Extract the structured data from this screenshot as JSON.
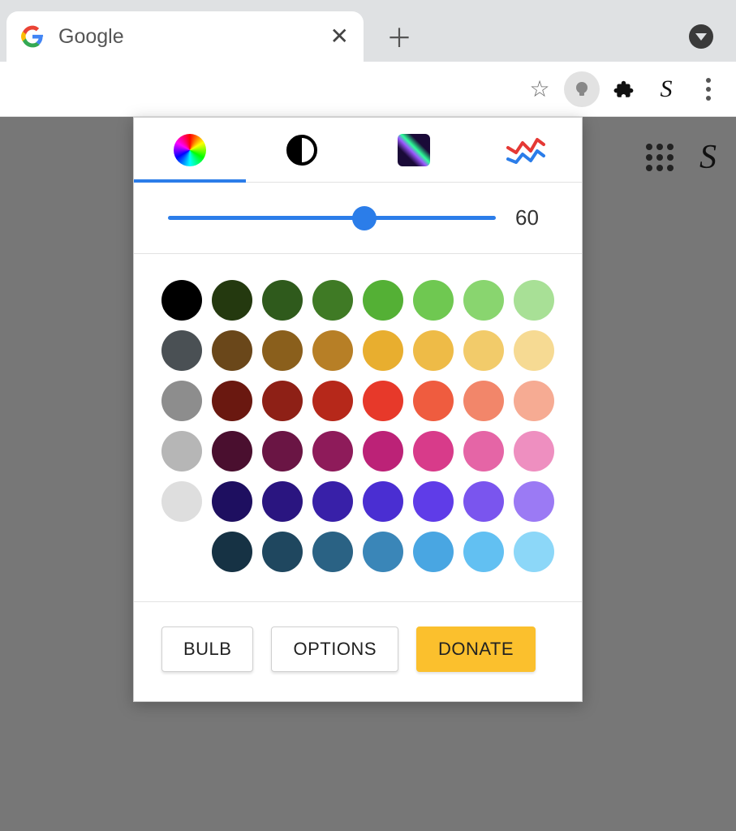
{
  "tab": {
    "title": "Google"
  },
  "popup": {
    "slider_value": "60",
    "slider_percent": 60,
    "buttons": {
      "bulb": "BULB",
      "options": "OPTIONS",
      "donate": "DONATE"
    },
    "swatches": [
      [
        "#000000",
        "#24390f",
        "#2f5a1c",
        "#3f7a25",
        "#54b035",
        "#6fc851",
        "#89d56f",
        "#a8e096"
      ],
      [
        "#4a5054",
        "#6a471a",
        "#8a5f1c",
        "#b77f26",
        "#e8ae2f",
        "#eebb47",
        "#f2cb6a",
        "#f6da93"
      ],
      [
        "#8d8d8d",
        "#6a1810",
        "#8e2016",
        "#b6281a",
        "#e7392a",
        "#ef5c3f",
        "#f2866a",
        "#f6ab93"
      ],
      [
        "#b6b6b6",
        "#4a0f2f",
        "#6a1544",
        "#8e1b5a",
        "#bc2277",
        "#d83b8a",
        "#e565a6",
        "#ee8fc0"
      ],
      [
        "#dedede",
        "#1e0f60",
        "#2a1580",
        "#3820a8",
        "#4a2ed2",
        "#5f3ce8",
        "#7a55ee",
        "#9b7af4"
      ],
      [
        null,
        "#163244",
        "#1f475f",
        "#2a6284",
        "#3a86b8",
        "#49a6e2",
        "#62c0f2",
        "#8cd7f8"
      ]
    ]
  }
}
